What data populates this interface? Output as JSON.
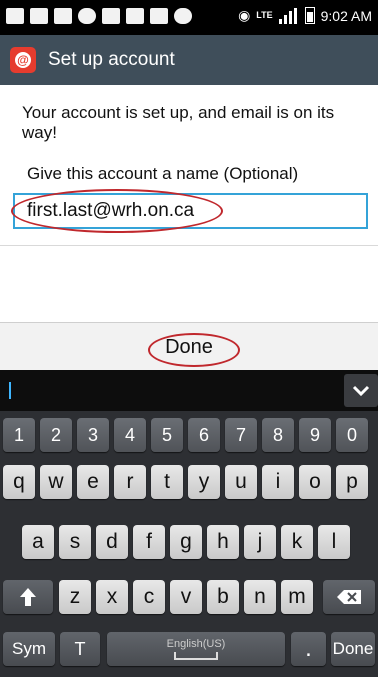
{
  "status_bar": {
    "time": "9:02 AM",
    "network": "LTE"
  },
  "title_bar": {
    "title": "Set up account"
  },
  "content": {
    "message": "Your account is set up, and email is on its way!",
    "field_label": "Give this account a name (Optional)",
    "account_name_value": "first.last@wrh.on.ca"
  },
  "action_bar": {
    "done_label": "Done"
  },
  "keyboard": {
    "number_row": [
      "1",
      "2",
      "3",
      "4",
      "5",
      "6",
      "7",
      "8",
      "9",
      "0"
    ],
    "row1": [
      "q",
      "w",
      "e",
      "r",
      "t",
      "y",
      "u",
      "i",
      "o",
      "p"
    ],
    "row2": [
      "a",
      "s",
      "d",
      "f",
      "g",
      "h",
      "j",
      "k",
      "l"
    ],
    "row3": [
      "z",
      "x",
      "c",
      "v",
      "b",
      "n",
      "m"
    ],
    "sym_label": "Sym",
    "space_label": "English(US)",
    "period_label": ".",
    "done_label": "Done"
  },
  "colors": {
    "title_bar": "#3f4e5a",
    "input_border": "#34a3d8",
    "annotation": "#c0282d",
    "keyboard_bg": "#2d2f33"
  }
}
